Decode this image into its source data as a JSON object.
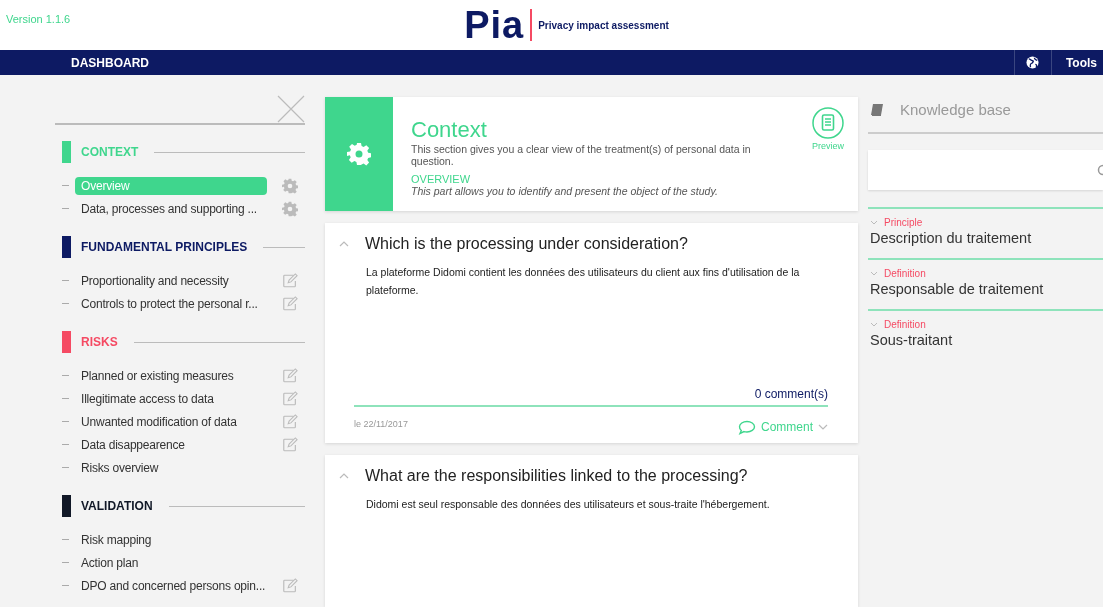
{
  "header": {
    "version": "Version 1.1.6",
    "logo": "Pia",
    "tagline": "Privacy impact assessment"
  },
  "nav": {
    "dashboard": "DASHBOARD",
    "tools": "Tools"
  },
  "sidebar": {
    "sections": [
      {
        "title": "CONTEXT",
        "color": "#3fd68d",
        "items": [
          {
            "label": "Overview",
            "kind": "gear",
            "selected": true
          },
          {
            "label": "Data, processes and supporting ...",
            "kind": "gear",
            "selected": false
          }
        ]
      },
      {
        "title": "FUNDAMENTAL PRINCIPLES",
        "color": "#0d1a63",
        "items": [
          {
            "label": "Proportionality and necessity",
            "kind": "edit",
            "selected": false
          },
          {
            "label": "Controls to protect the personal r...",
            "kind": "edit",
            "selected": false
          }
        ]
      },
      {
        "title": "RISKS",
        "color": "#f54a63",
        "items": [
          {
            "label": "Planned or existing measures",
            "kind": "edit",
            "selected": false
          },
          {
            "label": "Illegitimate access to data",
            "kind": "edit",
            "selected": false
          },
          {
            "label": "Unwanted modification of data",
            "kind": "edit",
            "selected": false
          },
          {
            "label": "Data disappearence",
            "kind": "edit",
            "selected": false
          },
          {
            "label": "Risks overview",
            "kind": "plain",
            "selected": false
          }
        ]
      },
      {
        "title": "VALIDATION",
        "color": "#111827",
        "items": [
          {
            "label": "Risk mapping",
            "kind": "plain",
            "selected": false
          },
          {
            "label": "Action plan",
            "kind": "plain",
            "selected": false
          },
          {
            "label": "DPO and concerned persons opin...",
            "kind": "edit",
            "selected": false
          }
        ]
      }
    ]
  },
  "section_card": {
    "title": "Context",
    "description": "This section gives you a clear view of the treatment(s) of personal data in question.",
    "subtitle": "OVERVIEW",
    "subdescription": "This part allows you to identify and present the object of the study.",
    "preview": "Preview"
  },
  "questions": [
    {
      "question": "Which is the processing under consideration?",
      "answer": "La plateforme Didomi contient les données des utilisateurs du client aux fins d'utilisation de la plateforme.",
      "comments_count": "0 comment(s)",
      "date": "le 22/11/2017",
      "comment_button": "Comment"
    },
    {
      "question": "What are the responsibilities linked to the processing?",
      "answer": "Didomi est seul responsable des données des utilisateurs et sous-traite l'hébergement."
    }
  ],
  "knowledge_base": {
    "title": "Knowledge base",
    "entries": [
      {
        "category": "Principle",
        "name": "Description du traitement"
      },
      {
        "category": "Definition",
        "name": "Responsable de traitement"
      },
      {
        "category": "Definition",
        "name": "Sous-traitant"
      }
    ]
  }
}
